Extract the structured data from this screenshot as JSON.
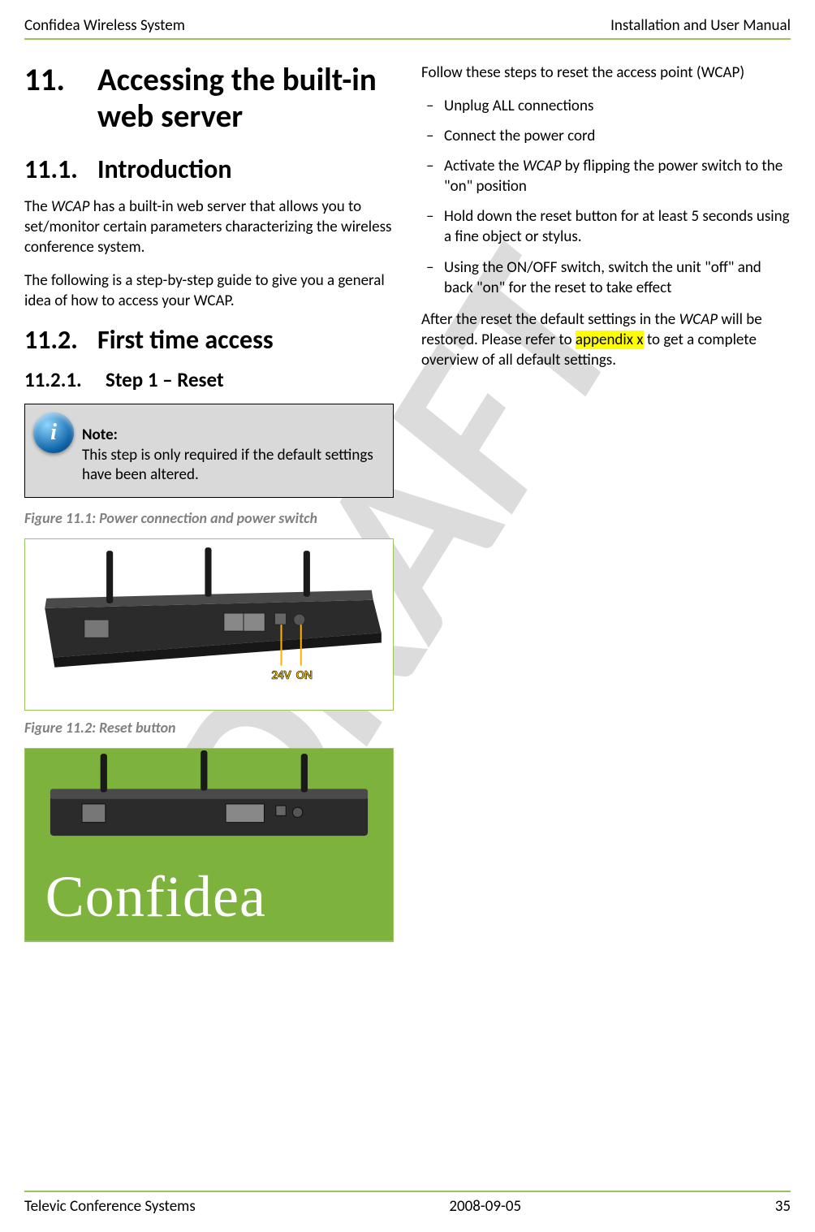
{
  "header": {
    "left": "Confidea Wireless System",
    "right": "Installation and User Manual"
  },
  "h1": {
    "num": "11.",
    "text": "Accessing the built-in web server"
  },
  "h2a": {
    "num": "11.1.",
    "text": "Introduction"
  },
  "p_intro_1_a": "The ",
  "p_intro_1_b": "WCAP",
  "p_intro_1_c": " has a built-in web server that allows you to set/monitor certain parameters characterizing the wireless conference system.",
  "p_intro_2": "The following is a step-by-step guide to give you a general idea of how to access your WCAP.",
  "h2b": {
    "num": "11.2.",
    "text": "First time access"
  },
  "h3a": {
    "num": "11.2.1.",
    "text": "Step 1 – Reset"
  },
  "note": {
    "label": "Note:",
    "body": "This step is only required if the default settings have been altered."
  },
  "fig1": "Figure 11.1: Power connection and power switch",
  "fig1_labels": {
    "v": "24V",
    "on": "ON"
  },
  "fig2": "Figure 11.2: Reset button",
  "confidea_logo_text": "Confidea",
  "right_intro": "Follow these steps to reset the access point (WCAP)",
  "steps": [
    "Unplug ALL connections",
    "Connect the power cord",
    "Activate the WCAP by flipping the power switch to the \"on\" position",
    "Hold down the reset button for at least 5 seconds using a fine object or stylus.",
    "Using the ON/OFF switch, switch the unit \"off\" and back \"on\" for the reset to take effect"
  ],
  "after_a": "After the reset the default settings in the ",
  "after_b": "WCAP",
  "after_c": " will be restored. Please refer to ",
  "after_hl": "appendix x",
  "after_d": " to get a complete overview of all default settings.",
  "footer": {
    "left": "Televic Conference Systems",
    "center": "2008-09-05",
    "right": "35"
  },
  "watermark": "DRAFT"
}
